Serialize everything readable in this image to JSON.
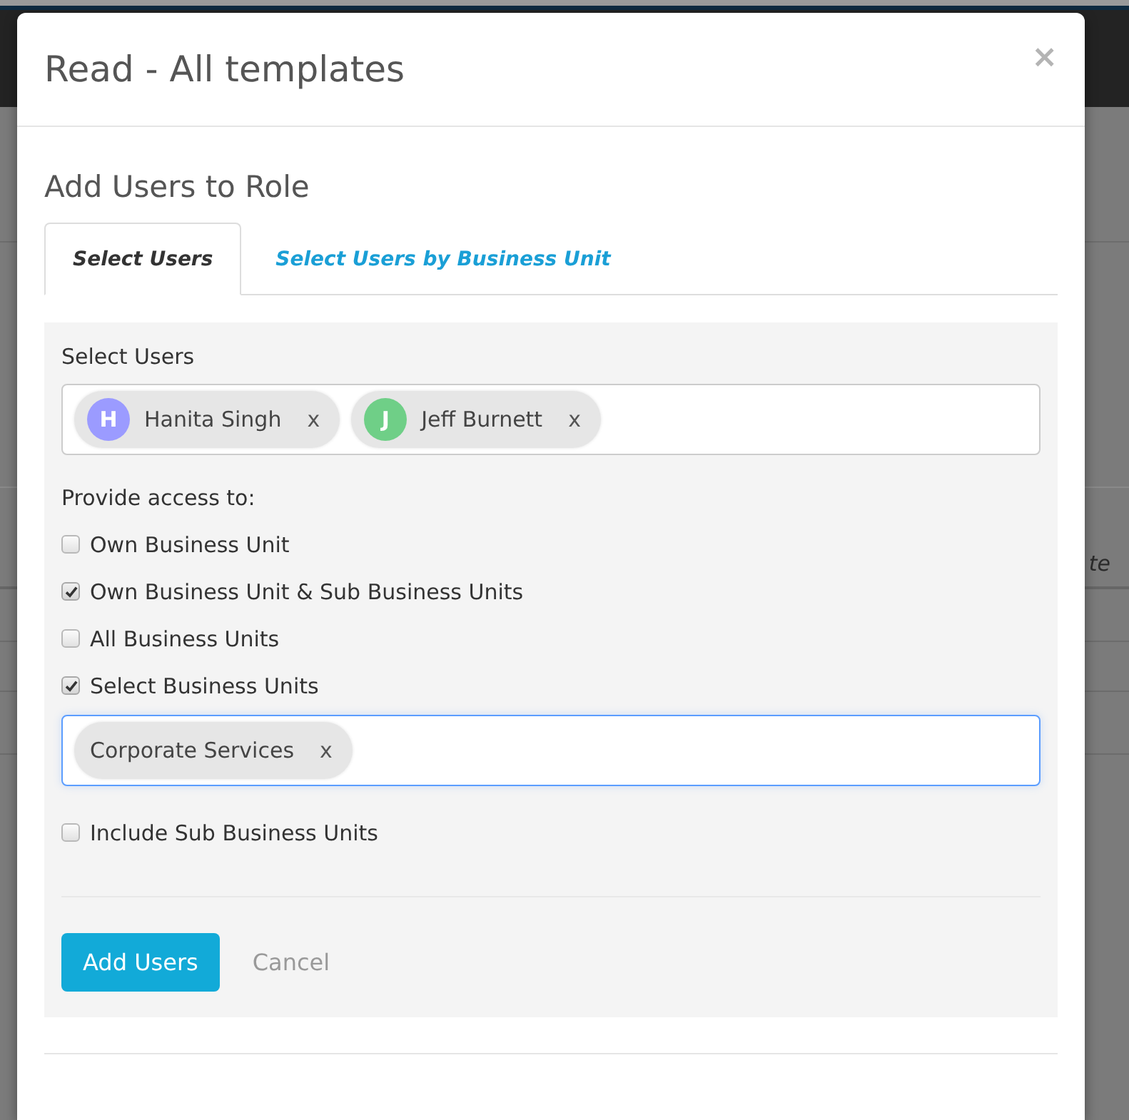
{
  "backdrop": {
    "table_header": "te"
  },
  "dialog": {
    "title": "Read - All templates",
    "close": "×"
  },
  "section_title": "Add Users to Role",
  "tabs": [
    {
      "label": "Select Users",
      "selected": true
    },
    {
      "label": "Select Users by Business Unit",
      "selected": false
    }
  ],
  "select_users": {
    "label": "Select Users",
    "focused": false,
    "chips": [
      {
        "initial": "H",
        "name": "Hanita Singh",
        "remove": "x",
        "color": "#9b9bff"
      },
      {
        "initial": "J",
        "name": "Jeff Burnett",
        "remove": "x",
        "color": "#6fcf87"
      }
    ]
  },
  "access": {
    "label": "Provide access to:",
    "options": [
      {
        "kind": "checkbox",
        "label": "Own Business Unit",
        "checked": false
      },
      {
        "kind": "checkbox",
        "label": "Own Business Unit & Sub Business Units",
        "checked": true
      },
      {
        "kind": "checkbox",
        "label": "All Business Units",
        "checked": false
      },
      {
        "kind": "checkbox",
        "label": "Select Business Units",
        "checked": true
      },
      {
        "kind": "tags",
        "focused": true,
        "chips": [
          {
            "label": "Corporate Services",
            "remove": "x"
          }
        ]
      },
      {
        "kind": "checkbox",
        "label": "Include Sub Business Units",
        "checked": false
      }
    ]
  },
  "actions": [
    {
      "kind": "primary",
      "label": "Add Users"
    },
    {
      "kind": "link",
      "label": "Cancel"
    }
  ]
}
